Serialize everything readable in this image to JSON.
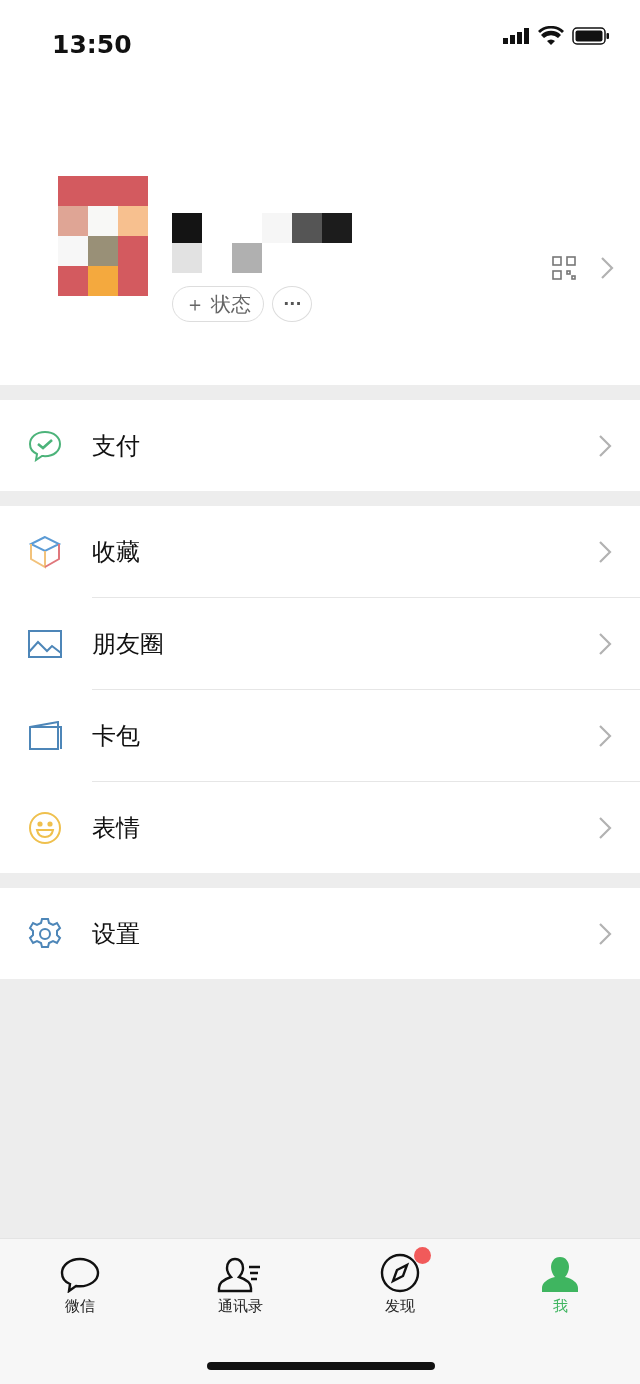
{
  "status_bar": {
    "time": "13:50"
  },
  "profile": {
    "status_button": "＋ 状态",
    "more_button": "···"
  },
  "menu_groups": [
    {
      "items": [
        {
          "label": "支付",
          "kind": "pay"
        }
      ]
    },
    {
      "items": [
        {
          "label": "收藏",
          "kind": "favorites"
        },
        {
          "label": "朋友圈",
          "kind": "moments"
        },
        {
          "label": "卡包",
          "kind": "cards"
        },
        {
          "label": "表情",
          "kind": "stickers"
        }
      ]
    },
    {
      "items": [
        {
          "label": "设置",
          "kind": "settings"
        }
      ]
    }
  ],
  "tab_bar": [
    {
      "label": "微信",
      "kind": "chats",
      "selected": false,
      "badge": false
    },
    {
      "label": "通讯录",
      "kind": "contacts",
      "selected": false,
      "badge": false
    },
    {
      "label": "发现",
      "kind": "discover",
      "selected": false,
      "badge": true
    },
    {
      "label": "我",
      "kind": "me",
      "selected": true,
      "badge": false
    }
  ]
}
